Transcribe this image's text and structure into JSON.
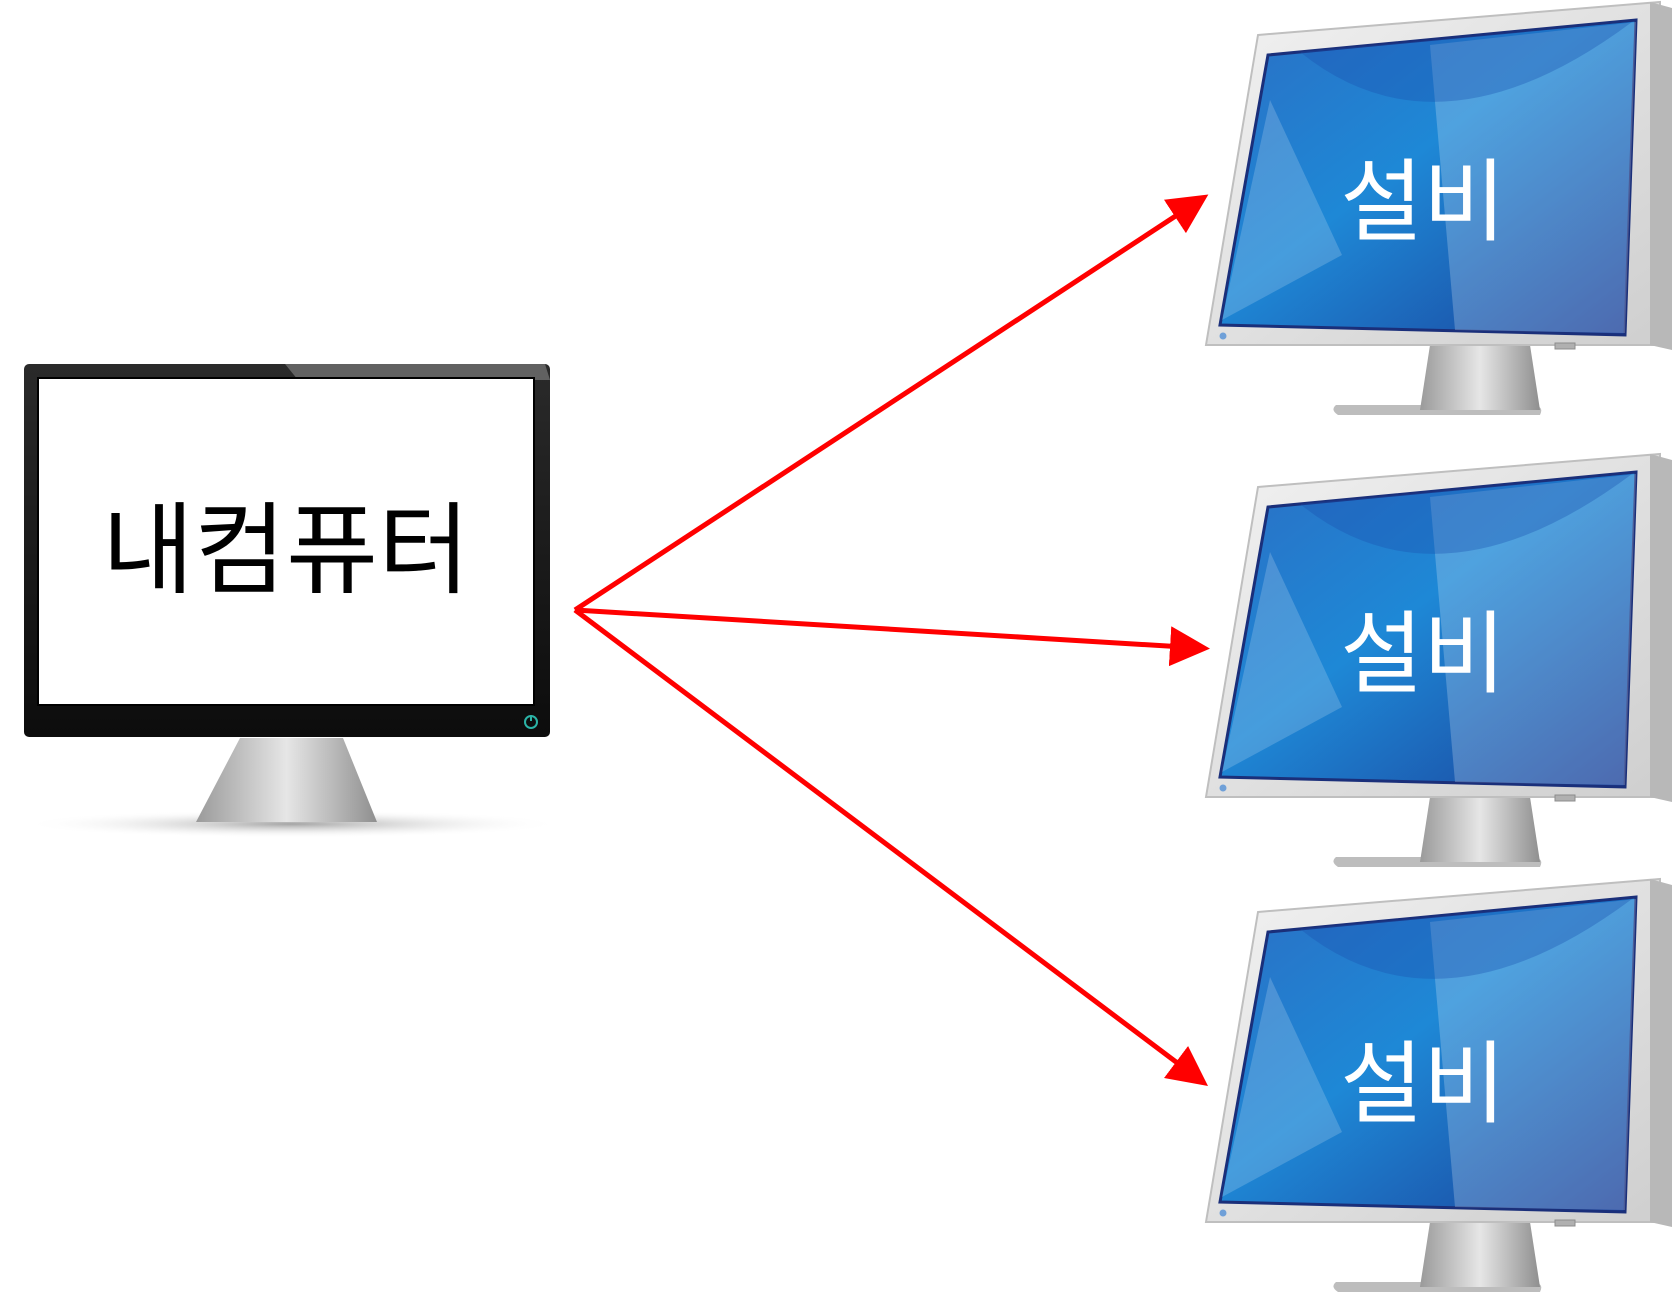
{
  "source_computer": {
    "label": "내컴퓨터",
    "screen_color": "#ffffff",
    "bezel_color": "#111111",
    "power_led_color": "#2bb3a6"
  },
  "devices": [
    {
      "label": "설비"
    },
    {
      "label": "설비"
    },
    {
      "label": "설비"
    }
  ],
  "colors": {
    "arrow": "#ff0000",
    "device_screen_dark": "#1f3e9a",
    "device_screen_light": "#2a9fdc",
    "device_bezel": "#d9d9d9",
    "device_label": "#ffffff"
  }
}
